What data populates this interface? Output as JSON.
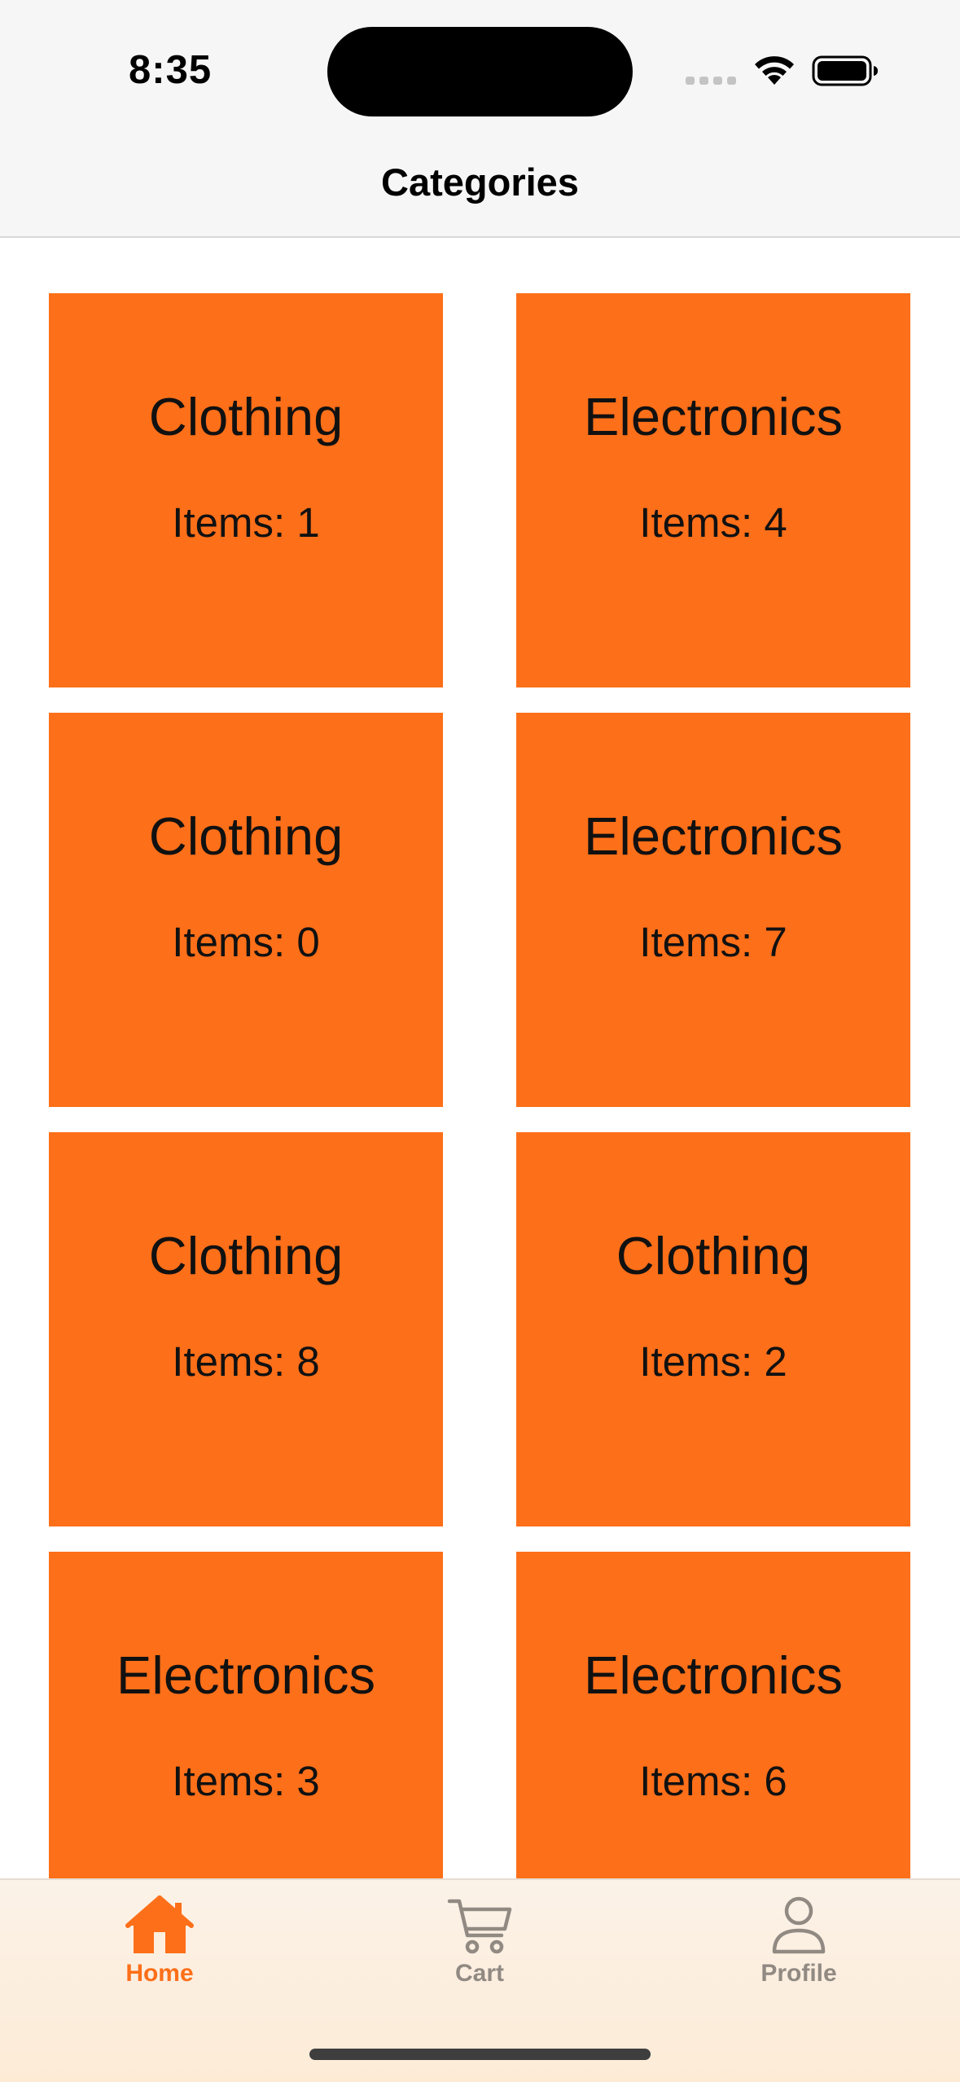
{
  "status_bar": {
    "time": "8:35"
  },
  "header": {
    "title": "Categories"
  },
  "categories": [
    {
      "name": "Clothing",
      "count_label": "Items: 1"
    },
    {
      "name": "Electronics",
      "count_label": "Items: 4"
    },
    {
      "name": "Clothing",
      "count_label": "Items: 0"
    },
    {
      "name": "Electronics",
      "count_label": "Items: 7"
    },
    {
      "name": "Clothing",
      "count_label": "Items: 8"
    },
    {
      "name": "Clothing",
      "count_label": "Items: 2"
    },
    {
      "name": "Electronics",
      "count_label": "Items: 3"
    },
    {
      "name": "Electronics",
      "count_label": "Items: 6"
    }
  ],
  "tab_bar": {
    "tabs": [
      {
        "label": "Home",
        "icon": "house-icon",
        "active": true
      },
      {
        "label": "Cart",
        "icon": "cart-icon",
        "active": false
      },
      {
        "label": "Profile",
        "icon": "person-icon",
        "active": false
      }
    ]
  },
  "colors": {
    "accent": "#fd6f19",
    "card_background": "#fd6f19",
    "inactive_tab": "#918a83",
    "header_background": "#f6f6f6"
  }
}
